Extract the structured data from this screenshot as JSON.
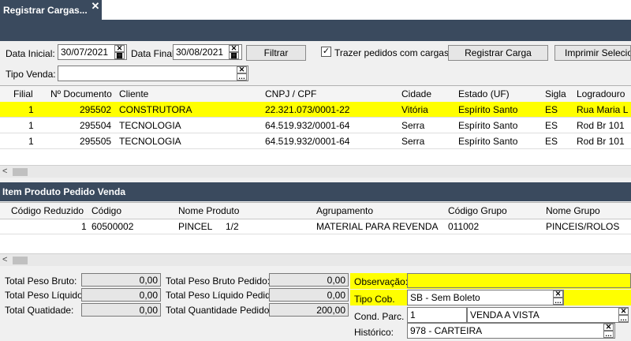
{
  "tab": {
    "title": "Registrar Cargas..."
  },
  "filters": {
    "data_inicial_label": "Data Inicial:",
    "data_inicial_value": "30/07/2021",
    "data_final_label": "Data Final:",
    "data_final_value": "30/08/2021",
    "filtrar_label": "Filtrar",
    "trazer_label": "Trazer pedidos com cargas",
    "trazer_checked": true,
    "registrar_label": "Registrar Carga",
    "imprimir_label": "Imprimir Selecionados",
    "tipo_venda_label": "Tipo Venda:",
    "tipo_venda_value": ""
  },
  "orders": {
    "columns": [
      "Filial",
      "Nº Documento",
      "Cliente",
      "CNPJ / CPF",
      "Cidade",
      "Estado (UF)",
      "Sigla",
      "Logradouro"
    ],
    "rows": [
      {
        "filial": "1",
        "documento": "295502",
        "cliente": "CONSTRUTORA",
        "cnpj": "22.321.073/0001-22",
        "cidade": "Vitória",
        "estado": "Espírito Santo",
        "sigla": "ES",
        "logradouro": "Rua Maria L"
      },
      {
        "filial": "1",
        "documento": "295504",
        "cliente": "TECNOLOGIA",
        "cnpj": "64.519.932/0001-64",
        "cidade": "Serra",
        "estado": "Espírito Santo",
        "sigla": "ES",
        "logradouro": "Rod Br 101"
      },
      {
        "filial": "1",
        "documento": "295505",
        "cliente": "TECNOLOGIA",
        "cnpj": "64.519.932/0001-64",
        "cidade": "Serra",
        "estado": "Espírito Santo",
        "sigla": "ES",
        "logradouro": "Rod Br 101"
      }
    ],
    "selected_row": 0
  },
  "items": {
    "title": "Item Produto Pedido Venda",
    "columns": [
      "Código Reduzido",
      "Código",
      "Nome Produto",
      "Agrupamento",
      "Código Grupo",
      "Nome Grupo"
    ],
    "rows": [
      {
        "reduzido": "1",
        "codigo": "60500002",
        "nome": "PINCEL",
        "medida": "1/2",
        "agrupamento": "MATERIAL PARA REVENDA",
        "codigo_grupo": "011002",
        "nome_grupo": "PINCEIS/ROLOS"
      }
    ]
  },
  "totals": {
    "peso_bruto_label": "Total Peso Bruto:",
    "peso_bruto": "0,00",
    "peso_liquido_label": "Total Peso Líquido:",
    "peso_liquido": "0,00",
    "quantidade_label": "Total Quatidade:",
    "quantidade": "0,00",
    "peso_bruto_pedido_label": "Total Peso Bruto Pedido:",
    "peso_bruto_pedido": "0,00",
    "peso_liquido_pedido_label": "Total Peso Líquido Pedido:",
    "peso_liquido_pedido": "0,00",
    "quantidade_pedido_label": "Total Quantidade Pedido:",
    "quantidade_pedido": "200,00"
  },
  "details": {
    "observacao_label": "Observação:",
    "observacao": "",
    "tipo_cob_label": "Tipo Cob.",
    "tipo_cob": "SB - Sem Boleto",
    "cond_parc_label": "Cond. Parc.",
    "cond_parc_code": "1",
    "cond_parc_desc": "VENDA A VISTA",
    "historico_label": "Histórico:",
    "historico": "978 - CARTEIRA"
  },
  "icons": {
    "close": "close-icon",
    "clear": "clear-x-icon",
    "calendar": "calendar-icon",
    "ellipsis": "ellipsis-icon",
    "scroll_left": "scroll-left-arrow-icon"
  },
  "colors": {
    "header_bar": "#3a4a5e",
    "selection": "#ffff00"
  }
}
